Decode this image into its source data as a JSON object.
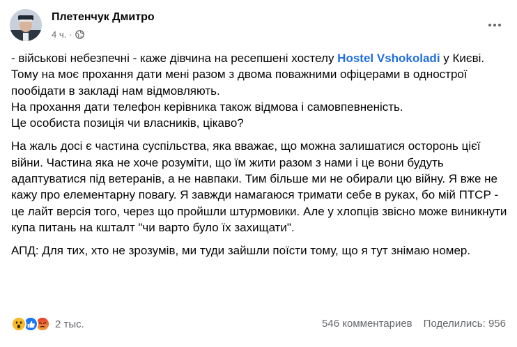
{
  "post": {
    "author": "Плетенчук Дмитро",
    "time": "4 ч.",
    "dot": "·",
    "audience_icon": "globe-icon",
    "more_icon": "more-options-icon"
  },
  "content": {
    "p1_before_link": "- військові небезпечні - каже дівчина на ресепшені хостелу ",
    "p1_link": "Hostel Vshokoladi",
    "p1_after_link": " у Києві. Тому на моє прохання дати мені разом з двома поважними офіцерами в однострої пообідати в закладі нам відмовляють.\nНа прохання дати телефон керівника також відмова і самовпевненість.\nЦе особиста позиція чи власників, цікаво?",
    "p2": "На жаль досі є частина суспільства, яка вважає, що можна залишатися осторонь цієї війни. Частина яка не хоче розуміти, що їм жити разом з нами і це вони будуть адаптуватися під ветеранів, а не навпаки. Тим більше ми не обирали цю війну. Я вже не кажу про елементарну повагу. Я завжди намагаюся тримати себе в руках, бо мій ПТСР - це лайт версія того, через що пройшли штурмовики. Але у хлопців звісно може виникнути купа питань на кшталт \"чи варто було їх захищати\".",
    "p3": "АПД: Для тих, хто не зрозумів, ми туди зайшли поїсти тому, що я тут знімаю номер."
  },
  "footer": {
    "reaction_icons": [
      "wow-reaction-icon",
      "like-reaction-icon",
      "angry-reaction-icon"
    ],
    "reaction_count": "2 тыс.",
    "comments": "546 комментариев",
    "shares": "Поделились: 956"
  },
  "colors": {
    "link": "#216fdb",
    "text": "#050505",
    "secondary": "#65676b",
    "like": "#1877f2",
    "wow": "#f7b928",
    "angry": "#e9710f"
  }
}
